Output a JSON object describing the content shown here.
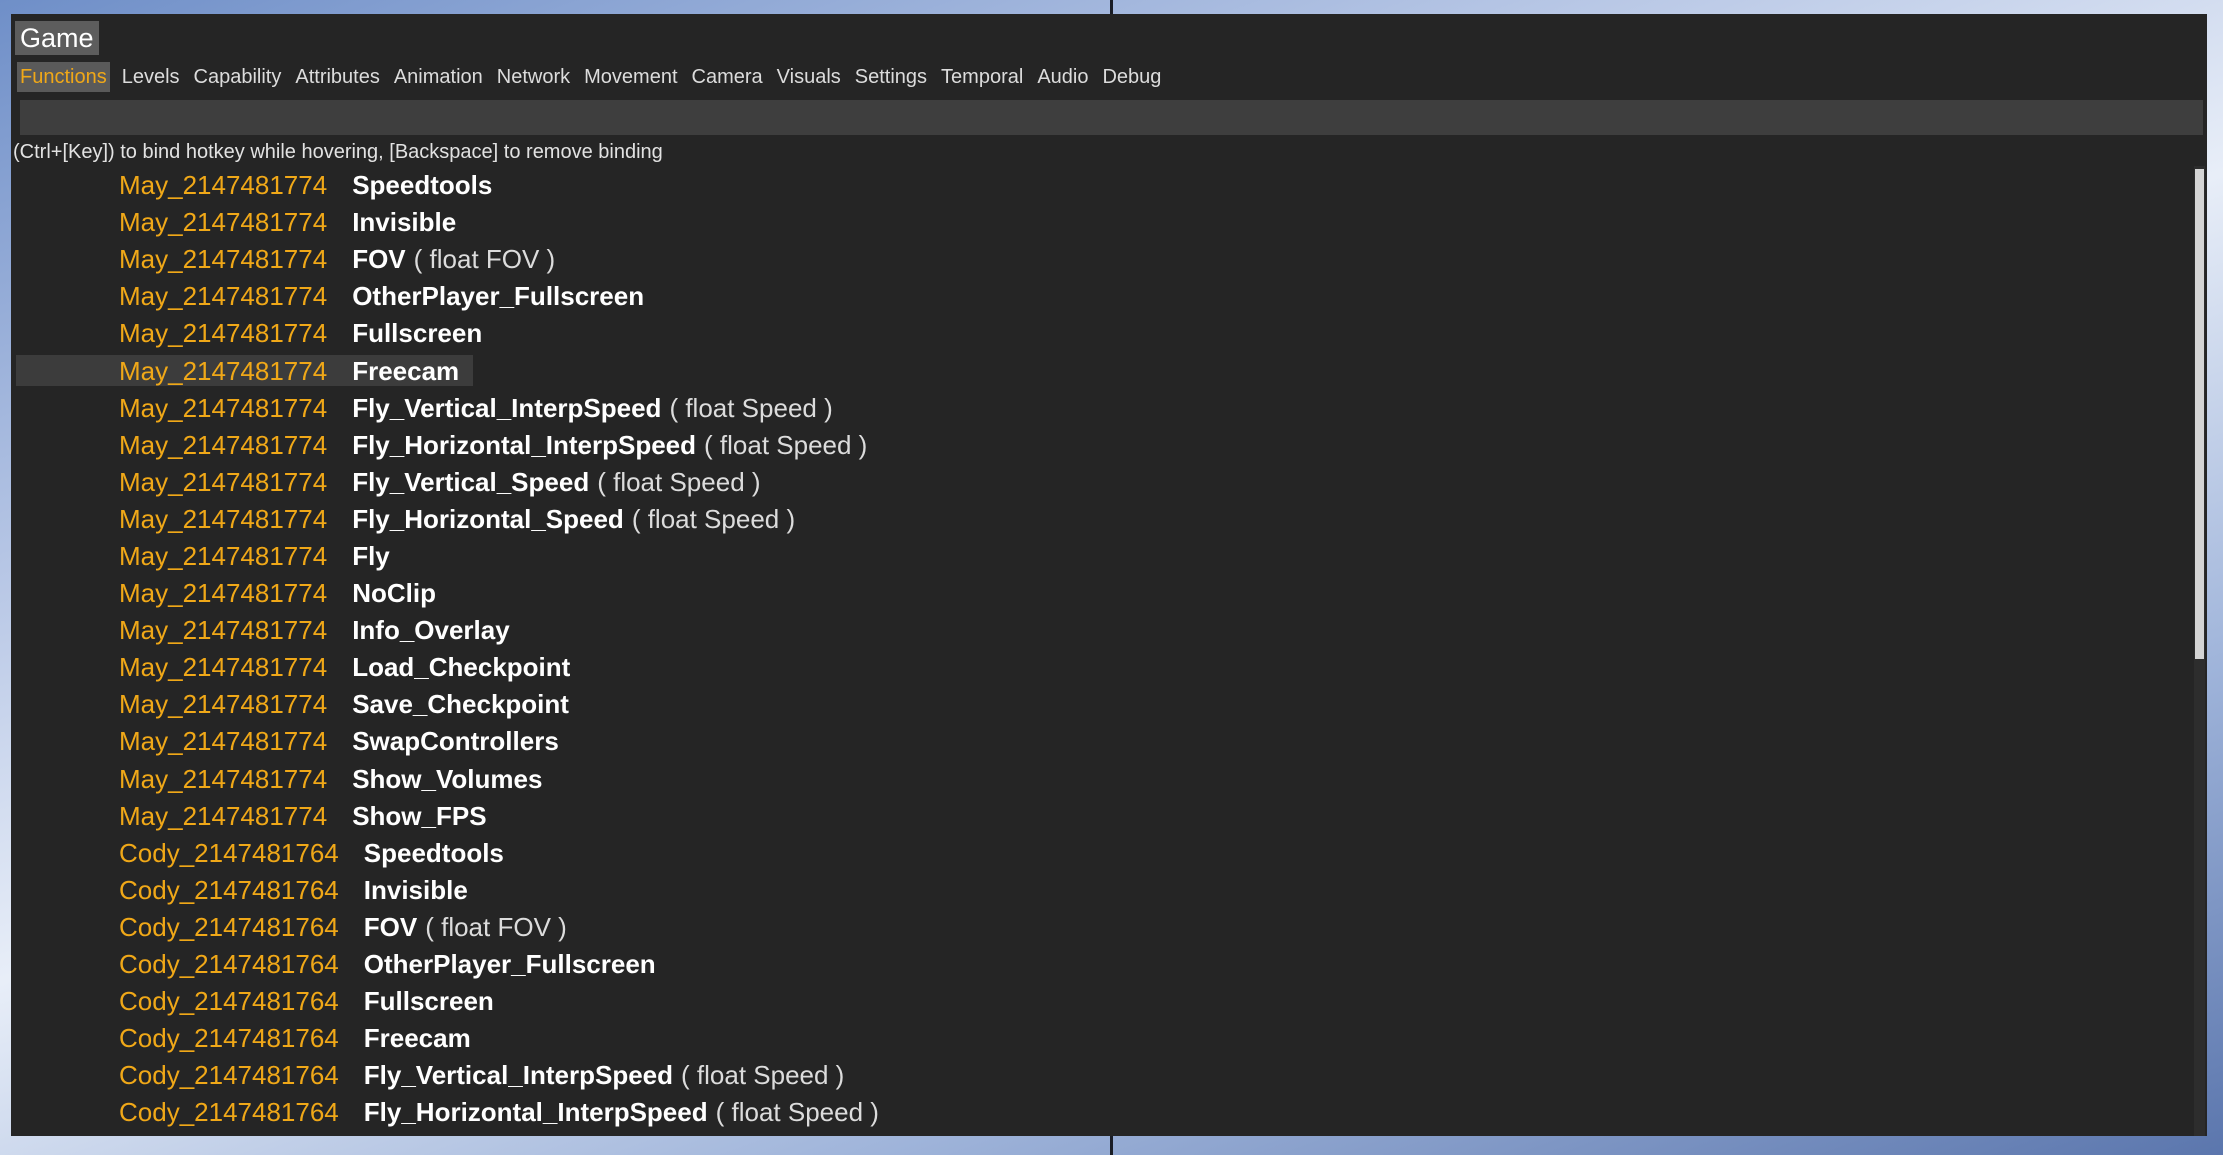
{
  "window": {
    "title": "Game"
  },
  "tabs": [
    "Functions",
    "Levels",
    "Capability",
    "Attributes",
    "Animation",
    "Network",
    "Movement",
    "Camera",
    "Visuals",
    "Settings",
    "Temporal",
    "Audio",
    "Debug"
  ],
  "active_tab": 0,
  "search": {
    "value": "",
    "placeholder": ""
  },
  "hint": "(Ctrl+[Key]) to bind hotkey while hovering, [Backspace] to remove binding",
  "highlighted_row": 5,
  "rows": [
    {
      "key": "May_2147481774",
      "func": "Speedtools",
      "params": ""
    },
    {
      "key": "May_2147481774",
      "func": "Invisible",
      "params": ""
    },
    {
      "key": "May_2147481774",
      "func": "FOV",
      "params": "( float FOV )"
    },
    {
      "key": "May_2147481774",
      "func": "OtherPlayer_Fullscreen",
      "params": ""
    },
    {
      "key": "May_2147481774",
      "func": "Fullscreen",
      "params": ""
    },
    {
      "key": "May_2147481774",
      "func": "Freecam",
      "params": ""
    },
    {
      "key": "May_2147481774",
      "func": "Fly_Vertical_InterpSpeed",
      "params": "( float Speed )"
    },
    {
      "key": "May_2147481774",
      "func": "Fly_Horizontal_InterpSpeed",
      "params": "( float Speed )"
    },
    {
      "key": "May_2147481774",
      "func": "Fly_Vertical_Speed",
      "params": "( float Speed )"
    },
    {
      "key": "May_2147481774",
      "func": "Fly_Horizontal_Speed",
      "params": "( float Speed )"
    },
    {
      "key": "May_2147481774",
      "func": "Fly",
      "params": ""
    },
    {
      "key": "May_2147481774",
      "func": "NoClip",
      "params": ""
    },
    {
      "key": "May_2147481774",
      "func": "Info_Overlay",
      "params": ""
    },
    {
      "key": "May_2147481774",
      "func": "Load_Checkpoint",
      "params": ""
    },
    {
      "key": "May_2147481774",
      "func": "Save_Checkpoint",
      "params": ""
    },
    {
      "key": "May_2147481774",
      "func": "SwapControllers",
      "params": ""
    },
    {
      "key": "May_2147481774",
      "func": "Show_Volumes",
      "params": ""
    },
    {
      "key": "May_2147481774",
      "func": "Show_FPS",
      "params": ""
    },
    {
      "key": "Cody_2147481764",
      "func": "Speedtools",
      "params": ""
    },
    {
      "key": "Cody_2147481764",
      "func": "Invisible",
      "params": ""
    },
    {
      "key": "Cody_2147481764",
      "func": "FOV",
      "params": "( float FOV )"
    },
    {
      "key": "Cody_2147481764",
      "func": "OtherPlayer_Fullscreen",
      "params": ""
    },
    {
      "key": "Cody_2147481764",
      "func": "Fullscreen",
      "params": ""
    },
    {
      "key": "Cody_2147481764",
      "func": "Freecam",
      "params": ""
    },
    {
      "key": "Cody_2147481764",
      "func": "Fly_Vertical_InterpSpeed",
      "params": "( float Speed )"
    },
    {
      "key": "Cody_2147481764",
      "func": "Fly_Horizontal_InterpSpeed",
      "params": "( float Speed )"
    }
  ],
  "colors": {
    "accent": "#f0a818",
    "panel": "#252525",
    "text": "#ffffff"
  }
}
